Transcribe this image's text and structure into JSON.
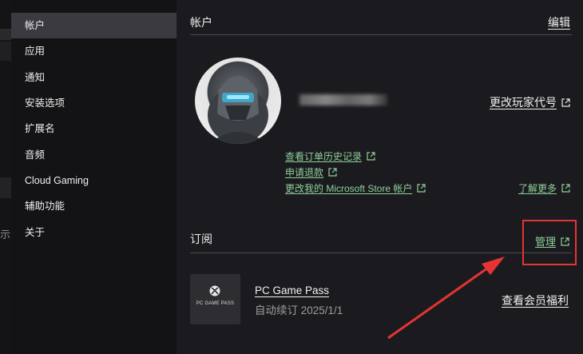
{
  "background_fragment": "示",
  "sidebar": {
    "items": [
      {
        "label": "帐户",
        "active": true
      },
      {
        "label": "应用"
      },
      {
        "label": "通知"
      },
      {
        "label": "安装选项"
      },
      {
        "label": "扩展名"
      },
      {
        "label": "音频"
      },
      {
        "label": "Cloud Gaming"
      },
      {
        "label": "辅助功能"
      },
      {
        "label": "关于"
      }
    ]
  },
  "account": {
    "title": "帐户",
    "edit_label": "编辑",
    "change_gamertag": "更改玩家代号",
    "links": {
      "order_history": "查看订单历史记录",
      "refund": "申请退款",
      "change_store_account": "更改我的 Microsoft Store 帐户",
      "learn_more": "了解更多"
    }
  },
  "subscriptions": {
    "title": "订阅",
    "manage_label": "管理",
    "item": {
      "tile_text": "PC GAME PASS",
      "name": "PC Game Pass",
      "renewal": "自动续订 2025/1/1",
      "benefits": "查看会员福利"
    }
  },
  "colors": {
    "accent_green": "#8fd19a",
    "annotation_red": "#e53434"
  }
}
